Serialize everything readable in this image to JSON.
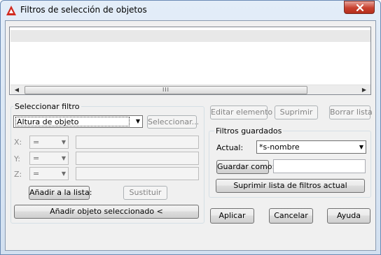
{
  "window": {
    "title": "Filtros de selección de objetos",
    "close_icon": "close-icon",
    "app_icon": "autocad-a-icon"
  },
  "filter_list": {
    "rows": [
      ""
    ]
  },
  "select_filter": {
    "legend": "Seleccionar filtro",
    "filter_type": "Altura de objeto",
    "select_button": "Seleccionar...",
    "x_label": "X:",
    "y_label": "Y:",
    "z_label": "Z:",
    "operator_value": "=",
    "add_to_list_button": "Añadir a la lista:",
    "replace_button": "Sustituir",
    "add_selected_button": "Añadir objeto seleccionado <"
  },
  "list_buttons": {
    "edit": "Editar elemento",
    "delete": "Suprimir",
    "clear": "Borrar lista"
  },
  "saved_filters": {
    "legend": "Filtros guardados",
    "current_label": "Actual:",
    "current_value": "*s-nombre",
    "save_as_button": "Guardar como:",
    "save_as_value": "",
    "delete_filter_button": "Suprimir lista de filtros actual"
  },
  "footer": {
    "apply": "Aplicar",
    "cancel": "Cancelar",
    "help": "Ayuda"
  },
  "colors": {
    "title_bar": "#d6e3f2",
    "close_button": "#c8412f",
    "dialog_bg": "#f0f0f0"
  }
}
